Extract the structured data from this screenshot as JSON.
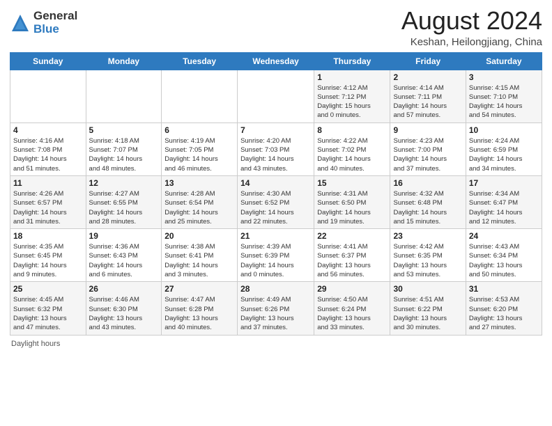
{
  "logo": {
    "general": "General",
    "blue": "Blue"
  },
  "header": {
    "month": "August 2024",
    "location": "Keshan, Heilongjiang, China"
  },
  "days_of_week": [
    "Sunday",
    "Monday",
    "Tuesday",
    "Wednesday",
    "Thursday",
    "Friday",
    "Saturday"
  ],
  "weeks": [
    [
      {
        "day": "",
        "info": ""
      },
      {
        "day": "",
        "info": ""
      },
      {
        "day": "",
        "info": ""
      },
      {
        "day": "",
        "info": ""
      },
      {
        "day": "1",
        "info": "Sunrise: 4:12 AM\nSunset: 7:12 PM\nDaylight: 15 hours\nand 0 minutes."
      },
      {
        "day": "2",
        "info": "Sunrise: 4:14 AM\nSunset: 7:11 PM\nDaylight: 14 hours\nand 57 minutes."
      },
      {
        "day": "3",
        "info": "Sunrise: 4:15 AM\nSunset: 7:10 PM\nDaylight: 14 hours\nand 54 minutes."
      }
    ],
    [
      {
        "day": "4",
        "info": "Sunrise: 4:16 AM\nSunset: 7:08 PM\nDaylight: 14 hours\nand 51 minutes."
      },
      {
        "day": "5",
        "info": "Sunrise: 4:18 AM\nSunset: 7:07 PM\nDaylight: 14 hours\nand 48 minutes."
      },
      {
        "day": "6",
        "info": "Sunrise: 4:19 AM\nSunset: 7:05 PM\nDaylight: 14 hours\nand 46 minutes."
      },
      {
        "day": "7",
        "info": "Sunrise: 4:20 AM\nSunset: 7:03 PM\nDaylight: 14 hours\nand 43 minutes."
      },
      {
        "day": "8",
        "info": "Sunrise: 4:22 AM\nSunset: 7:02 PM\nDaylight: 14 hours\nand 40 minutes."
      },
      {
        "day": "9",
        "info": "Sunrise: 4:23 AM\nSunset: 7:00 PM\nDaylight: 14 hours\nand 37 minutes."
      },
      {
        "day": "10",
        "info": "Sunrise: 4:24 AM\nSunset: 6:59 PM\nDaylight: 14 hours\nand 34 minutes."
      }
    ],
    [
      {
        "day": "11",
        "info": "Sunrise: 4:26 AM\nSunset: 6:57 PM\nDaylight: 14 hours\nand 31 minutes."
      },
      {
        "day": "12",
        "info": "Sunrise: 4:27 AM\nSunset: 6:55 PM\nDaylight: 14 hours\nand 28 minutes."
      },
      {
        "day": "13",
        "info": "Sunrise: 4:28 AM\nSunset: 6:54 PM\nDaylight: 14 hours\nand 25 minutes."
      },
      {
        "day": "14",
        "info": "Sunrise: 4:30 AM\nSunset: 6:52 PM\nDaylight: 14 hours\nand 22 minutes."
      },
      {
        "day": "15",
        "info": "Sunrise: 4:31 AM\nSunset: 6:50 PM\nDaylight: 14 hours\nand 19 minutes."
      },
      {
        "day": "16",
        "info": "Sunrise: 4:32 AM\nSunset: 6:48 PM\nDaylight: 14 hours\nand 15 minutes."
      },
      {
        "day": "17",
        "info": "Sunrise: 4:34 AM\nSunset: 6:47 PM\nDaylight: 14 hours\nand 12 minutes."
      }
    ],
    [
      {
        "day": "18",
        "info": "Sunrise: 4:35 AM\nSunset: 6:45 PM\nDaylight: 14 hours\nand 9 minutes."
      },
      {
        "day": "19",
        "info": "Sunrise: 4:36 AM\nSunset: 6:43 PM\nDaylight: 14 hours\nand 6 minutes."
      },
      {
        "day": "20",
        "info": "Sunrise: 4:38 AM\nSunset: 6:41 PM\nDaylight: 14 hours\nand 3 minutes."
      },
      {
        "day": "21",
        "info": "Sunrise: 4:39 AM\nSunset: 6:39 PM\nDaylight: 14 hours\nand 0 minutes."
      },
      {
        "day": "22",
        "info": "Sunrise: 4:41 AM\nSunset: 6:37 PM\nDaylight: 13 hours\nand 56 minutes."
      },
      {
        "day": "23",
        "info": "Sunrise: 4:42 AM\nSunset: 6:35 PM\nDaylight: 13 hours\nand 53 minutes."
      },
      {
        "day": "24",
        "info": "Sunrise: 4:43 AM\nSunset: 6:34 PM\nDaylight: 13 hours\nand 50 minutes."
      }
    ],
    [
      {
        "day": "25",
        "info": "Sunrise: 4:45 AM\nSunset: 6:32 PM\nDaylight: 13 hours\nand 47 minutes."
      },
      {
        "day": "26",
        "info": "Sunrise: 4:46 AM\nSunset: 6:30 PM\nDaylight: 13 hours\nand 43 minutes."
      },
      {
        "day": "27",
        "info": "Sunrise: 4:47 AM\nSunset: 6:28 PM\nDaylight: 13 hours\nand 40 minutes."
      },
      {
        "day": "28",
        "info": "Sunrise: 4:49 AM\nSunset: 6:26 PM\nDaylight: 13 hours\nand 37 minutes."
      },
      {
        "day": "29",
        "info": "Sunrise: 4:50 AM\nSunset: 6:24 PM\nDaylight: 13 hours\nand 33 minutes."
      },
      {
        "day": "30",
        "info": "Sunrise: 4:51 AM\nSunset: 6:22 PM\nDaylight: 13 hours\nand 30 minutes."
      },
      {
        "day": "31",
        "info": "Sunrise: 4:53 AM\nSunset: 6:20 PM\nDaylight: 13 hours\nand 27 minutes."
      }
    ]
  ],
  "footer": {
    "text": "Daylight hours"
  }
}
